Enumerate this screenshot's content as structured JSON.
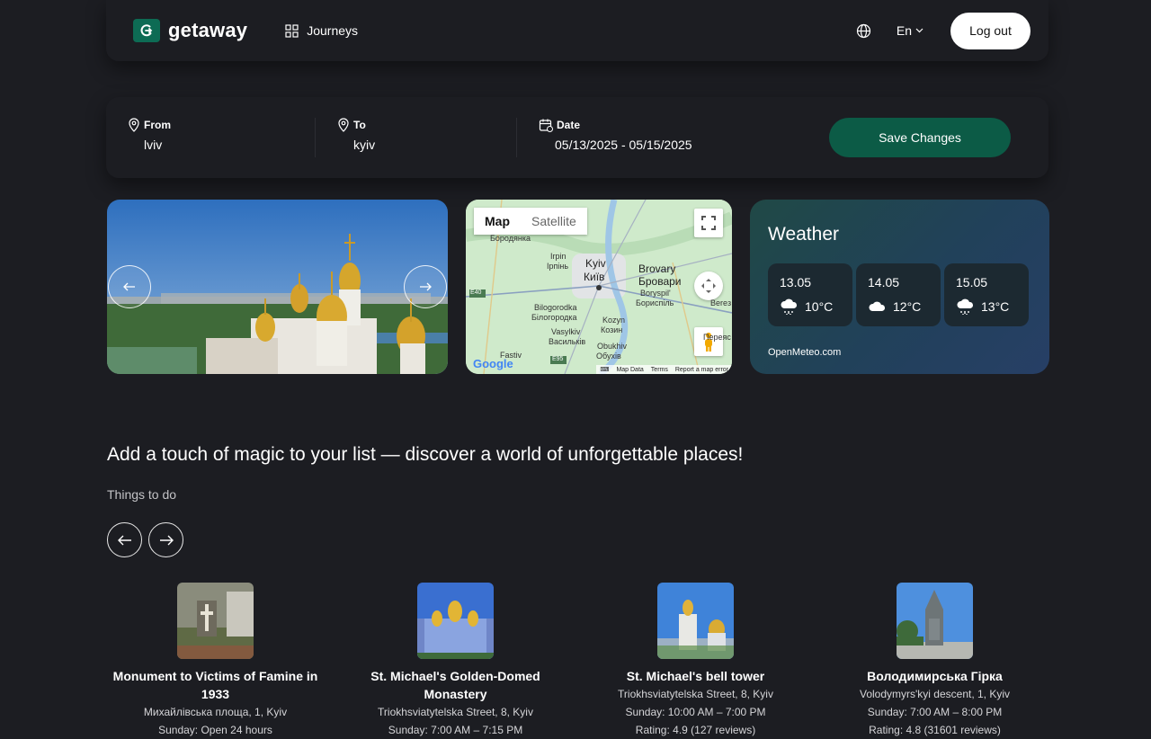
{
  "header": {
    "logo_text": "getaway",
    "nav_journeys": "Journeys",
    "language": "En",
    "logout_label": "Log out"
  },
  "search": {
    "from_label": "From",
    "from_value": "lviv",
    "to_label": "To",
    "to_value": "kyiv",
    "date_label": "Date",
    "date_value": "05/13/2025 - 05/15/2025",
    "save_label": "Save Changes"
  },
  "map": {
    "tab_map": "Map",
    "tab_satellite": "Satellite",
    "labels": [
      "Бородянка",
      "Irpin",
      "Ірпінь",
      "Kyiv",
      "Київ",
      "Brovary",
      "Бровари",
      "Boryspil'",
      "Бориспіль",
      "Bilogorodka",
      "Білогородка",
      "Kozyn",
      "Козин",
      "Vasylkiv",
      "Васильків",
      "Obukhiv",
      "Обухів",
      "Fastiv",
      "E40",
      "E95",
      "Bereз",
      "Переяс"
    ],
    "footer": {
      "map_data": "Map Data",
      "terms": "Terms",
      "report": "Report a map error"
    },
    "google": "Google"
  },
  "weather": {
    "title": "Weather",
    "days": [
      {
        "date": "13.05",
        "temp": "10°C",
        "icon": "rain-cloud-icon"
      },
      {
        "date": "14.05",
        "temp": "12°C",
        "icon": "cloud-icon"
      },
      {
        "date": "15.05",
        "temp": "13°C",
        "icon": "rain-cloud-icon"
      }
    ],
    "source": "OpenMeteo.com"
  },
  "discover": {
    "heading": "Add a touch of magic to your list — discover a world of unforgettable places!",
    "subheading": "Things to do"
  },
  "places": [
    {
      "title": "Monument to Victims of Famine in 1933",
      "address": "Михайлівська площа, 1, Kyiv",
      "line3": "Sunday: Open 24 hours"
    },
    {
      "title": "St. Michael's Golden-Domed Monastery",
      "address": "Triokhsviatytelska Street, 8, Kyiv",
      "line3": "Sunday: 7:00 AM – 7:15 PM"
    },
    {
      "title": "St. Michael's bell tower",
      "address": "Triokhsviatytelska Street, 8, Kyiv",
      "line3": "Sunday: 10:00 AM – 7:00 PM",
      "line4": "Rating: 4.9 (127 reviews)"
    },
    {
      "title": "Володимирська Гірка",
      "address": "Volodymyrs'kyi descent, 1, Kyiv",
      "line3": "Sunday: 7:00 AM – 8:00 PM",
      "line4": "Rating: 4.8 (31601 reviews)"
    }
  ],
  "colors": {
    "accent": "#0c5b46",
    "background": "#1c1d22"
  }
}
